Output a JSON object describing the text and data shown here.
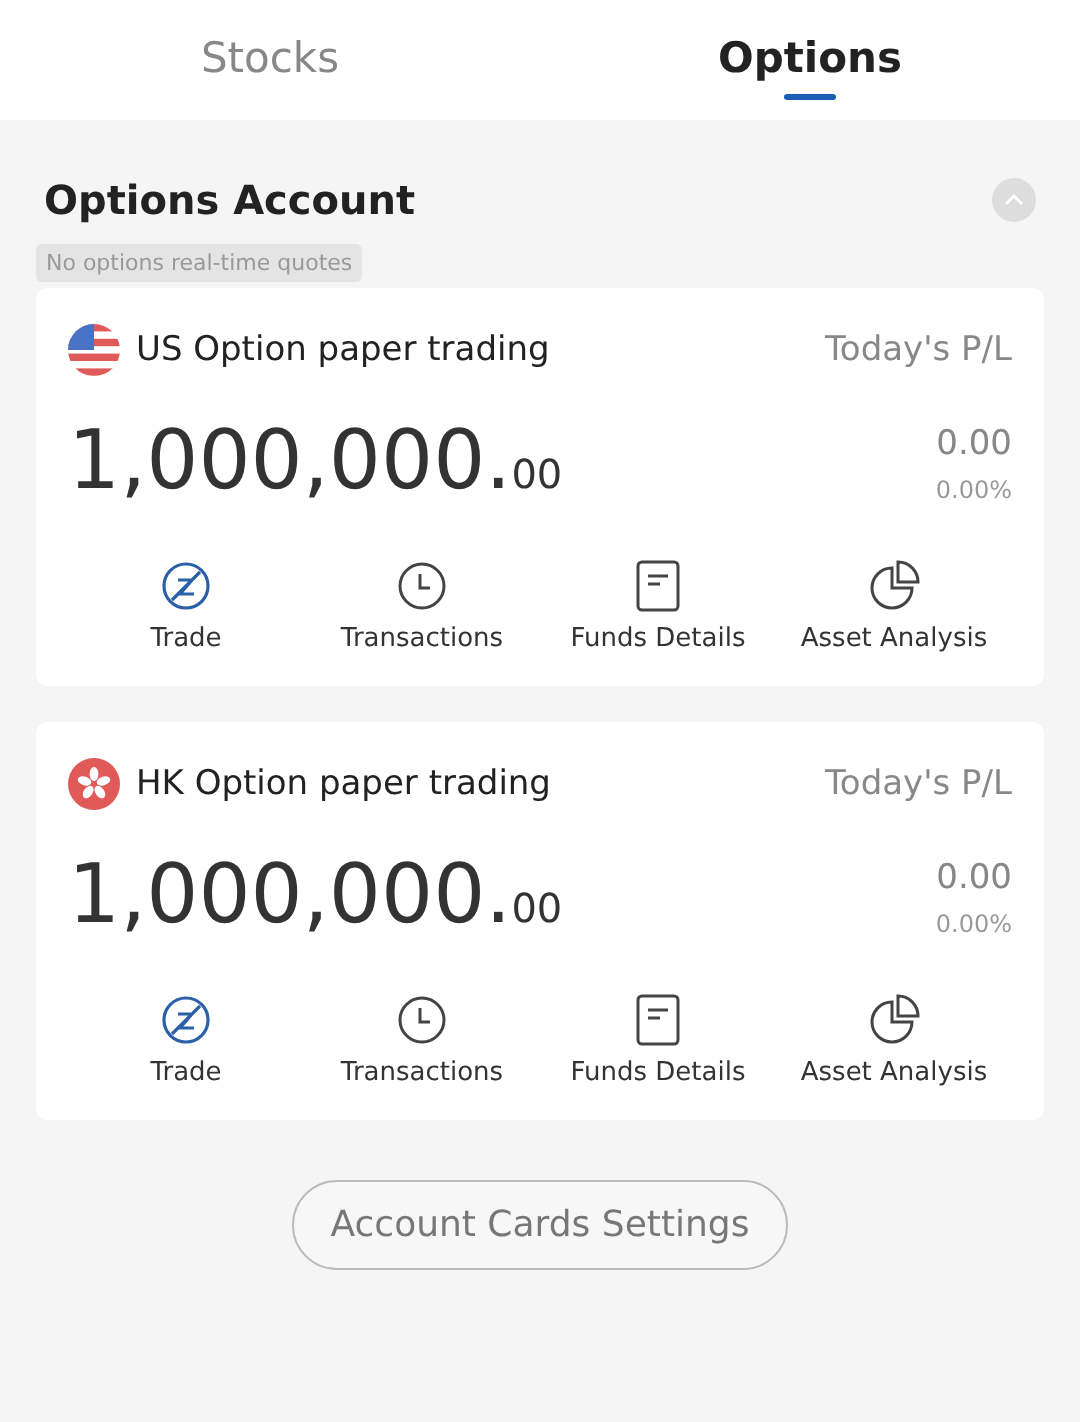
{
  "tabs": [
    {
      "label": "Stocks",
      "selected": false
    },
    {
      "label": "Options",
      "selected": true
    }
  ],
  "section": {
    "title": "Options Account"
  },
  "accounts": [
    {
      "badge": "No options real-time quotes",
      "kind": "us",
      "name": "US Option paper trading",
      "pl_label": "Today's P/L",
      "balance_main": "1,000,000.",
      "balance_decimals": "00",
      "pl_value": "0.00",
      "pl_percent": "0.00%",
      "actions": [
        {
          "kind": "trade",
          "label": "Trade"
        },
        {
          "kind": "clock",
          "label": "Transactions"
        },
        {
          "kind": "document",
          "label": "Funds Details"
        },
        {
          "kind": "pie",
          "label": "Asset Analysis"
        }
      ]
    },
    {
      "kind": "hk",
      "name": "HK Option paper trading",
      "pl_label": "Today's P/L",
      "balance_main": "1,000,000.",
      "balance_decimals": "00",
      "pl_value": "0.00",
      "pl_percent": "0.00%",
      "actions": [
        {
          "kind": "trade",
          "label": "Trade"
        },
        {
          "kind": "clock",
          "label": "Transactions"
        },
        {
          "kind": "document",
          "label": "Funds Details"
        },
        {
          "kind": "pie",
          "label": "Asset Analysis"
        }
      ]
    }
  ],
  "settings_button": "Account Cards Settings"
}
